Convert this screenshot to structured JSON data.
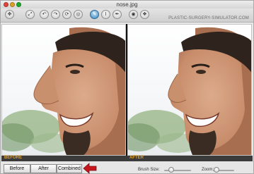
{
  "window": {
    "title": "nose.jpg",
    "brand": "PLASTIC-SURGERY-SIMULATOR.COM"
  },
  "toolbar": {
    "tools": [
      {
        "icon": "move-icon",
        "glyph": "✥",
        "active": false
      },
      {
        "icon": "fit-icon",
        "glyph": "⤢",
        "active": false
      },
      {
        "icon": "expand-icon",
        "glyph": "⤡",
        "active": false
      },
      {
        "icon": "undo-icon",
        "glyph": "↶",
        "active": false
      },
      {
        "icon": "redo-icon",
        "glyph": "↷",
        "active": false
      },
      {
        "icon": "rotate-icon",
        "glyph": "⟳",
        "active": false
      },
      {
        "icon": "reshape-icon",
        "glyph": "◎",
        "active": false
      },
      {
        "icon": "warp-brush-icon",
        "glyph": "✎",
        "active": true
      },
      {
        "icon": "text-icon",
        "glyph": "Ⅰ",
        "active": false
      },
      {
        "icon": "pen-icon",
        "glyph": "✒",
        "active": false
      },
      {
        "icon": "camera-icon",
        "glyph": "◉",
        "active": false
      },
      {
        "icon": "scan-icon",
        "glyph": "❖",
        "active": false
      }
    ]
  },
  "strip": {
    "before": "BEFORE",
    "after": "AFTER"
  },
  "buttons": {
    "before": "Before",
    "after": "After",
    "combined": "Combined"
  },
  "controls": {
    "brush_label": "Brush Size:",
    "zoom_label": "Zoom:"
  },
  "colors": {
    "accent": "#f0a11b",
    "arrow": "#c8161d"
  }
}
